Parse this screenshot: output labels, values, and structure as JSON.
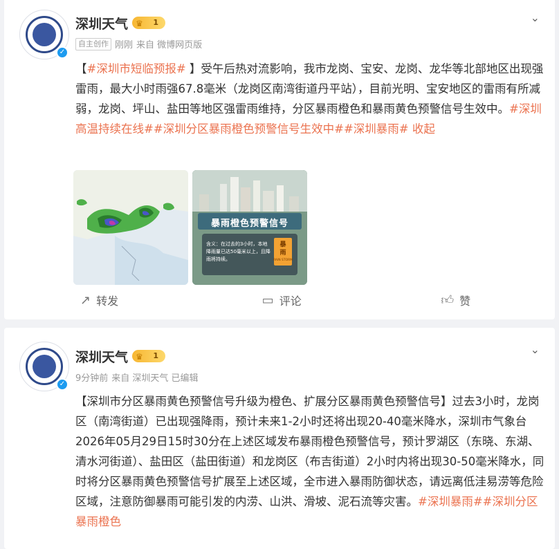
{
  "posts": [
    {
      "author": "深圳天气",
      "badge_level": "1",
      "meta": {
        "tag": "自主创作",
        "time": "刚刚",
        "source": "来自 微博网页版"
      },
      "text": [
        {
          "t": "【",
          "h": false
        },
        {
          "t": "#深圳市短临预报#",
          "h": true
        },
        {
          "t": " 】受午后热对流影响，我市龙岗、宝安、龙岗、龙华等北部地区出现强雷雨，最大小时雨强67.8毫米（龙岗区南湾街道丹平站），目前光明、宝安地区的雷雨有所减弱，龙岗、坪山、盐田等地区强雷雨维持，分区暴雨橙色和暴雨黄色预警信号生效中。",
          "h": false
        },
        {
          "t": "#深圳高温持续在线#",
          "h": true
        },
        {
          "t": "#深圳分区暴雨橙色预警信号生效中#",
          "h": true
        },
        {
          "t": "#深圳暴雨#",
          "h": true
        },
        {
          "t": " 收起",
          "h": true
        }
      ],
      "poster": {
        "title": "暴雨橙色预警信号",
        "desc": "含义：在过去的3小时，本地降雨量已达50毫米以上，且降雨将持续。",
        "sign_top": "暴",
        "sign_mid": "雨",
        "sign_en": "RAIN STORM"
      },
      "actions": {
        "repost": "转发",
        "comment": "评论",
        "like": "赞"
      }
    },
    {
      "author": "深圳天气",
      "badge_level": "1",
      "meta": {
        "time": "9分钟前",
        "source": "来自 深圳天气 已编辑"
      },
      "text": [
        {
          "t": "【深圳市分区暴雨黄色预警信号升级为橙色、扩展分区暴雨黄色预警信号】过去3小时，龙岗区（南湾街道）已出现强降雨，预计未来1-2小时还将出现20-40毫米降水，深圳市气象台2026年05月29日15时30分在上述区域发布暴雨橙色预警信号，预计罗湖区（东晓、东湖、清水河街道）、盐田区（盐田街道）和龙岗区（布吉街道）2小时内将出现30-50毫米降水，同时将分区暴雨黄色预警信号扩展至上述区域，全市进入暴雨防御状态，请远离低洼易涝等危险区域，注意防御暴雨可能引发的内涝、山洪、滑坡、泥石流等灾害。",
          "h": false
        },
        {
          "t": "#深圳暴雨#",
          "h": true
        },
        {
          "t": "#深圳分区暴雨橙色",
          "h": true
        }
      ]
    }
  ]
}
